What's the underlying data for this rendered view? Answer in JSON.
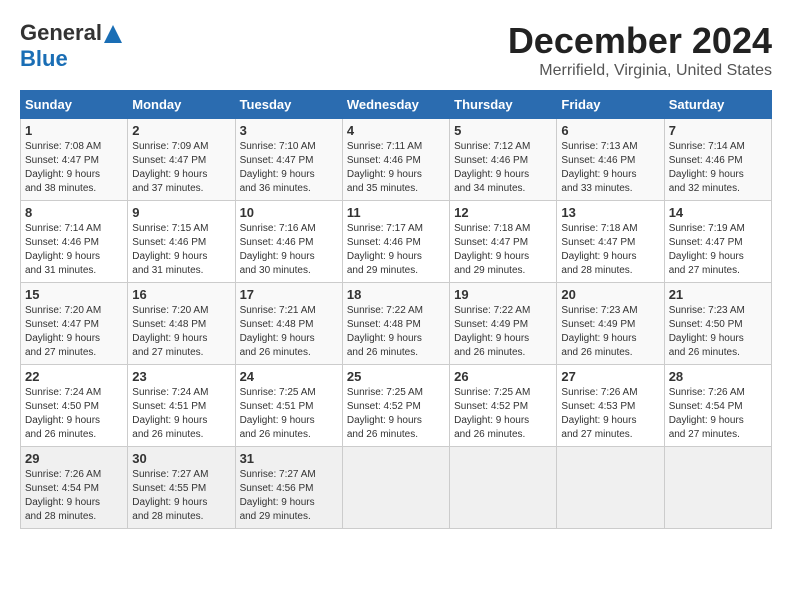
{
  "header": {
    "logo_line1": "General",
    "logo_line2": "Blue",
    "month": "December 2024",
    "location": "Merrifield, Virginia, United States"
  },
  "days_of_week": [
    "Sunday",
    "Monday",
    "Tuesday",
    "Wednesday",
    "Thursday",
    "Friday",
    "Saturday"
  ],
  "weeks": [
    [
      {
        "day": "1",
        "info": "Sunrise: 7:08 AM\nSunset: 4:47 PM\nDaylight: 9 hours\nand 38 minutes."
      },
      {
        "day": "2",
        "info": "Sunrise: 7:09 AM\nSunset: 4:47 PM\nDaylight: 9 hours\nand 37 minutes."
      },
      {
        "day": "3",
        "info": "Sunrise: 7:10 AM\nSunset: 4:47 PM\nDaylight: 9 hours\nand 36 minutes."
      },
      {
        "day": "4",
        "info": "Sunrise: 7:11 AM\nSunset: 4:46 PM\nDaylight: 9 hours\nand 35 minutes."
      },
      {
        "day": "5",
        "info": "Sunrise: 7:12 AM\nSunset: 4:46 PM\nDaylight: 9 hours\nand 34 minutes."
      },
      {
        "day": "6",
        "info": "Sunrise: 7:13 AM\nSunset: 4:46 PM\nDaylight: 9 hours\nand 33 minutes."
      },
      {
        "day": "7",
        "info": "Sunrise: 7:14 AM\nSunset: 4:46 PM\nDaylight: 9 hours\nand 32 minutes."
      }
    ],
    [
      {
        "day": "8",
        "info": "Sunrise: 7:14 AM\nSunset: 4:46 PM\nDaylight: 9 hours\nand 31 minutes."
      },
      {
        "day": "9",
        "info": "Sunrise: 7:15 AM\nSunset: 4:46 PM\nDaylight: 9 hours\nand 31 minutes."
      },
      {
        "day": "10",
        "info": "Sunrise: 7:16 AM\nSunset: 4:46 PM\nDaylight: 9 hours\nand 30 minutes."
      },
      {
        "day": "11",
        "info": "Sunrise: 7:17 AM\nSunset: 4:46 PM\nDaylight: 9 hours\nand 29 minutes."
      },
      {
        "day": "12",
        "info": "Sunrise: 7:18 AM\nSunset: 4:47 PM\nDaylight: 9 hours\nand 29 minutes."
      },
      {
        "day": "13",
        "info": "Sunrise: 7:18 AM\nSunset: 4:47 PM\nDaylight: 9 hours\nand 28 minutes."
      },
      {
        "day": "14",
        "info": "Sunrise: 7:19 AM\nSunset: 4:47 PM\nDaylight: 9 hours\nand 27 minutes."
      }
    ],
    [
      {
        "day": "15",
        "info": "Sunrise: 7:20 AM\nSunset: 4:47 PM\nDaylight: 9 hours\nand 27 minutes."
      },
      {
        "day": "16",
        "info": "Sunrise: 7:20 AM\nSunset: 4:48 PM\nDaylight: 9 hours\nand 27 minutes."
      },
      {
        "day": "17",
        "info": "Sunrise: 7:21 AM\nSunset: 4:48 PM\nDaylight: 9 hours\nand 26 minutes."
      },
      {
        "day": "18",
        "info": "Sunrise: 7:22 AM\nSunset: 4:48 PM\nDaylight: 9 hours\nand 26 minutes."
      },
      {
        "day": "19",
        "info": "Sunrise: 7:22 AM\nSunset: 4:49 PM\nDaylight: 9 hours\nand 26 minutes."
      },
      {
        "day": "20",
        "info": "Sunrise: 7:23 AM\nSunset: 4:49 PM\nDaylight: 9 hours\nand 26 minutes."
      },
      {
        "day": "21",
        "info": "Sunrise: 7:23 AM\nSunset: 4:50 PM\nDaylight: 9 hours\nand 26 minutes."
      }
    ],
    [
      {
        "day": "22",
        "info": "Sunrise: 7:24 AM\nSunset: 4:50 PM\nDaylight: 9 hours\nand 26 minutes."
      },
      {
        "day": "23",
        "info": "Sunrise: 7:24 AM\nSunset: 4:51 PM\nDaylight: 9 hours\nand 26 minutes."
      },
      {
        "day": "24",
        "info": "Sunrise: 7:25 AM\nSunset: 4:51 PM\nDaylight: 9 hours\nand 26 minutes."
      },
      {
        "day": "25",
        "info": "Sunrise: 7:25 AM\nSunset: 4:52 PM\nDaylight: 9 hours\nand 26 minutes."
      },
      {
        "day": "26",
        "info": "Sunrise: 7:25 AM\nSunset: 4:52 PM\nDaylight: 9 hours\nand 26 minutes."
      },
      {
        "day": "27",
        "info": "Sunrise: 7:26 AM\nSunset: 4:53 PM\nDaylight: 9 hours\nand 27 minutes."
      },
      {
        "day": "28",
        "info": "Sunrise: 7:26 AM\nSunset: 4:54 PM\nDaylight: 9 hours\nand 27 minutes."
      }
    ],
    [
      {
        "day": "29",
        "info": "Sunrise: 7:26 AM\nSunset: 4:54 PM\nDaylight: 9 hours\nand 28 minutes."
      },
      {
        "day": "30",
        "info": "Sunrise: 7:27 AM\nSunset: 4:55 PM\nDaylight: 9 hours\nand 28 minutes."
      },
      {
        "day": "31",
        "info": "Sunrise: 7:27 AM\nSunset: 4:56 PM\nDaylight: 9 hours\nand 29 minutes."
      },
      {
        "day": "",
        "info": ""
      },
      {
        "day": "",
        "info": ""
      },
      {
        "day": "",
        "info": ""
      },
      {
        "day": "",
        "info": ""
      }
    ]
  ]
}
